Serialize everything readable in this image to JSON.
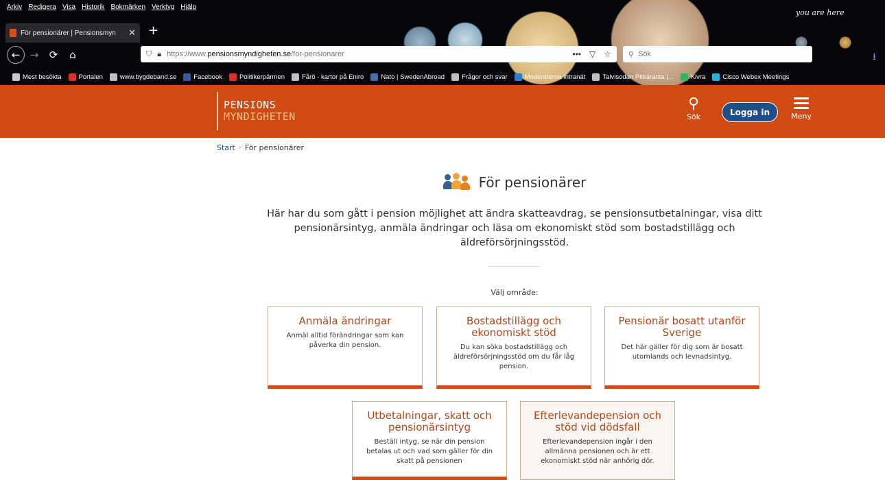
{
  "browser": {
    "menu": [
      "Arkiv",
      "Redigera",
      "Visa",
      "Historik",
      "Bokmärken",
      "Verktyg",
      "Hjälp"
    ],
    "hint": "you are here",
    "tab_title": "För pensionärer | Pensionsmyn",
    "url_prefix": "https://www.",
    "url_domain": "pensionsmyndigheten.se",
    "url_path": "/for-pensionarer",
    "search_placeholder": "Sök",
    "bookmarks": [
      {
        "label": "Mest besökta",
        "color": "#c8c8c8"
      },
      {
        "label": "Portalen",
        "color": "#d6322b"
      },
      {
        "label": "www.bygdeband.se",
        "color": "#bfbfbf"
      },
      {
        "label": "Facebook",
        "color": "#3b5998"
      },
      {
        "label": "Politikerpärmen",
        "color": "#d6322b"
      },
      {
        "label": "Fårö - kartor på Eniro",
        "color": "#bfbfbf"
      },
      {
        "label": "Nato | SwedenAbroad",
        "color": "#4a6ea9"
      },
      {
        "label": "Frågor och svar",
        "color": "#bfbfbf"
      },
      {
        "label": "Moderaterna Intranät",
        "color": "#2f7ecb"
      },
      {
        "label": "Talvisodan Pitkäranta |...",
        "color": "#bfbfbf"
      },
      {
        "label": "Kivra",
        "color": "#36b35a"
      },
      {
        "label": "Cisco Webex Meetings",
        "color": "#2bb0d8"
      }
    ]
  },
  "header": {
    "logo_line1": "PENSIONS",
    "logo_line2": "MYNDIGHETEN",
    "search_label": "Sök",
    "login_label": "Logga in",
    "menu_label": "Meny",
    "brand_color": "#d14a12",
    "login_color": "#1f4e89"
  },
  "breadcrumb": {
    "start": "Start",
    "current": "För pensionärer"
  },
  "page": {
    "title": "För pensionärer",
    "intro": "Här har du som gått i pension möjlighet att ändra skatteavdrag, se pensionsutbetalningar, visa ditt pensionärsintyg, anmäla ändringar och läsa om ekonomiskt stöd som bostadstillägg och äldreförsörjningsstöd.",
    "choose_label": "Välj område:"
  },
  "cards": [
    {
      "title": "Anmäla ändringar",
      "text": "Anmäl alltid förändringar som kan påverka din pension."
    },
    {
      "title": "Bostadstillägg och ekonomiskt stöd",
      "text": "Du kan söka bostadstillägg och äldreförsörjningsstöd om du får låg pension."
    },
    {
      "title": "Pensionär bosatt utanför Sverige",
      "text": "Det här gäller för dig som är bosatt utomlands och levnadsintyg."
    },
    {
      "title": "Utbetalningar, skatt och pensionärsintyg",
      "text": "Beställ intyg, se när din pension betalas ut och vad som gäller för din skatt på pensionen"
    },
    {
      "title": "Efterlevandepension och stöd vid dödsfall",
      "text": "Efterlevandepension ingår i den allmänna pensionen och är ett ekonomiskt stöd när anhörig dör."
    }
  ]
}
